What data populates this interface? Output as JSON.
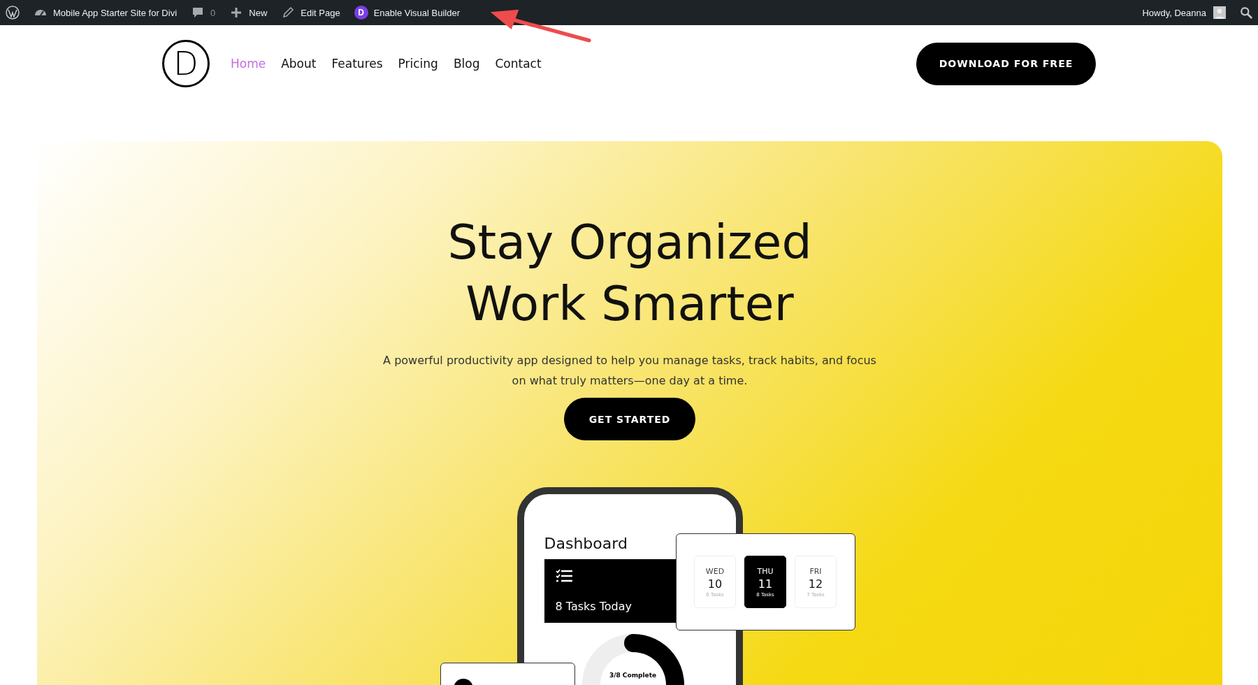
{
  "admin_bar": {
    "items": [
      {
        "kind": "wp"
      },
      {
        "kind": "site",
        "label": "Mobile App Starter Site for Divi"
      },
      {
        "kind": "comments",
        "label": "0"
      },
      {
        "kind": "new",
        "label": "New"
      },
      {
        "kind": "edit",
        "label": "Edit Page"
      },
      {
        "kind": "divi",
        "label": "Enable Visual Builder",
        "letter": "D"
      }
    ],
    "greeting": "Howdy, Deanna"
  },
  "header": {
    "logo_letter": "D",
    "nav": [
      {
        "label": "Home",
        "selected": true
      },
      {
        "label": "About",
        "selected": false
      },
      {
        "label": "Features",
        "selected": false
      },
      {
        "label": "Pricing",
        "selected": false
      },
      {
        "label": "Blog",
        "selected": false
      },
      {
        "label": "Contact",
        "selected": false
      }
    ],
    "cta": "DOWNLOAD FOR FREE"
  },
  "hero": {
    "title_lines": [
      "Stay Organized",
      "Work Smarter"
    ],
    "text": "A powerful productivity app designed to help you manage tasks, track habits, and focus on what truly matters—one day at a time.",
    "button": "GET STARTED",
    "phone": {
      "title": "Dashboard",
      "tasks_card": "8 Tasks Today",
      "progress": {
        "label": "3/8 Complete"
      },
      "days": [
        {
          "day": "WED",
          "date": "10",
          "tasks": "0 Tasks",
          "selected": false
        },
        {
          "day": "THU",
          "date": "11",
          "tasks": "8 Tasks",
          "selected": true
        },
        {
          "day": "FRI",
          "date": "12",
          "tasks": "7 Tasks",
          "selected": false
        }
      ]
    }
  }
}
